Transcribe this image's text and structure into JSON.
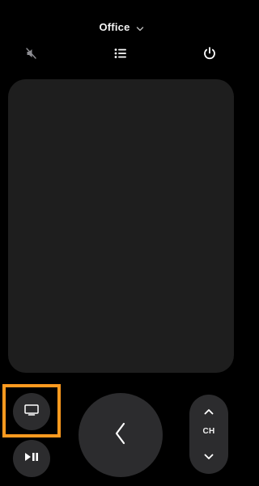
{
  "header": {
    "device_name": "Office",
    "picker_icon": "chevron-down-icon"
  },
  "toolbar": {
    "mute_icon": "speaker-muted-icon",
    "list_icon": "list-icon",
    "power_icon": "power-icon"
  },
  "controls": {
    "tv_icon": "tv-icon",
    "play_pause_icon": "play-pause-icon",
    "back_icon": "chevron-left-icon",
    "channel_label": "CH",
    "channel_up_icon": "chevron-up-icon",
    "channel_down_icon": "chevron-down-icon"
  },
  "colors": {
    "background": "#000000",
    "touchpad": "#1e1e1e",
    "button": "#2c2c2e",
    "highlight": "#ff9a1f",
    "foreground": "#ffffff"
  }
}
